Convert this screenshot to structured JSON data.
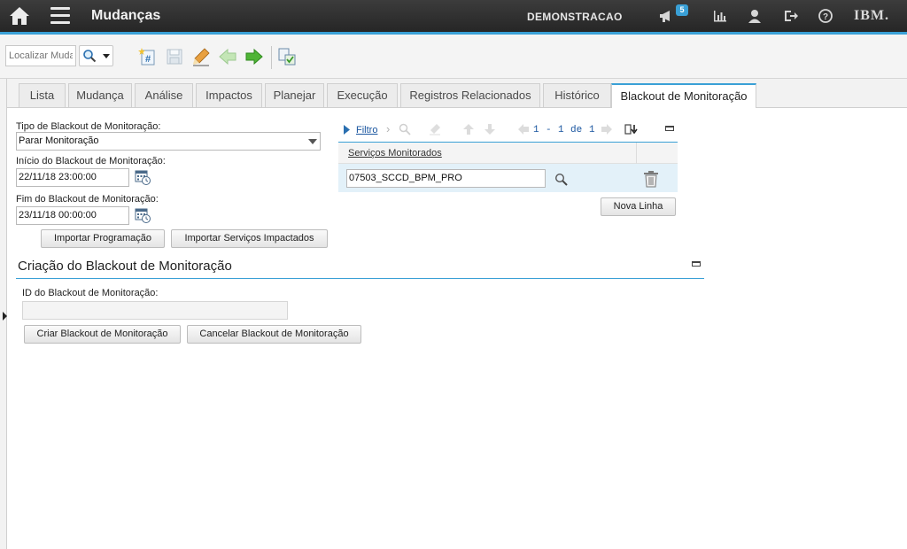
{
  "header": {
    "app_title": "Mudanças",
    "org_name": "DEMONSTRACAO",
    "notification_count": "5",
    "brand": "IBM."
  },
  "toolbar": {
    "search_placeholder": "Localizar Muda"
  },
  "tabs": [
    {
      "label": "Lista"
    },
    {
      "label": "Mudança"
    },
    {
      "label": "Análise"
    },
    {
      "label": "Impactos"
    },
    {
      "label": "Planejar"
    },
    {
      "label": "Execução"
    },
    {
      "label": "Registros Relacionados"
    },
    {
      "label": "Histórico"
    },
    {
      "label": "Blackout de Monitoração"
    }
  ],
  "form": {
    "tipo_label": "Tipo de Blackout de Monitoração:",
    "tipo_value": "Parar Monitoração",
    "inicio_label": "Início do Blackout de Monitoração:",
    "inicio_value": "22/11/18 23:00:00",
    "fim_label": "Fim do Blackout de Monitoração:",
    "fim_value": "23/11/18 00:00:00",
    "import_schedule_button": "Importar Programação",
    "import_services_button": "Importar Serviços Impactados"
  },
  "services_table": {
    "filter_label": "Filtro",
    "pagination": {
      "first": "1",
      "dash": "-",
      "last": "1",
      "of": "de",
      "total": "1"
    },
    "column_header": "Serviços Monitorados",
    "rows": [
      {
        "service": "07503_SCCD_BPM_PRO"
      }
    ],
    "new_row_button": "Nova Linha"
  },
  "creation_section": {
    "title": "Criação do Blackout de Monitoração",
    "id_label": "ID do Blackout de Monitoração:",
    "id_value": "",
    "create_button": "Criar Blackout de Monitoração",
    "cancel_button": "Cancelar Blackout de Monitoração"
  },
  "colors": {
    "accent": "#3aa0d6",
    "header_bg": "#2e2e2e",
    "selected_row": "#e3f1f9"
  }
}
